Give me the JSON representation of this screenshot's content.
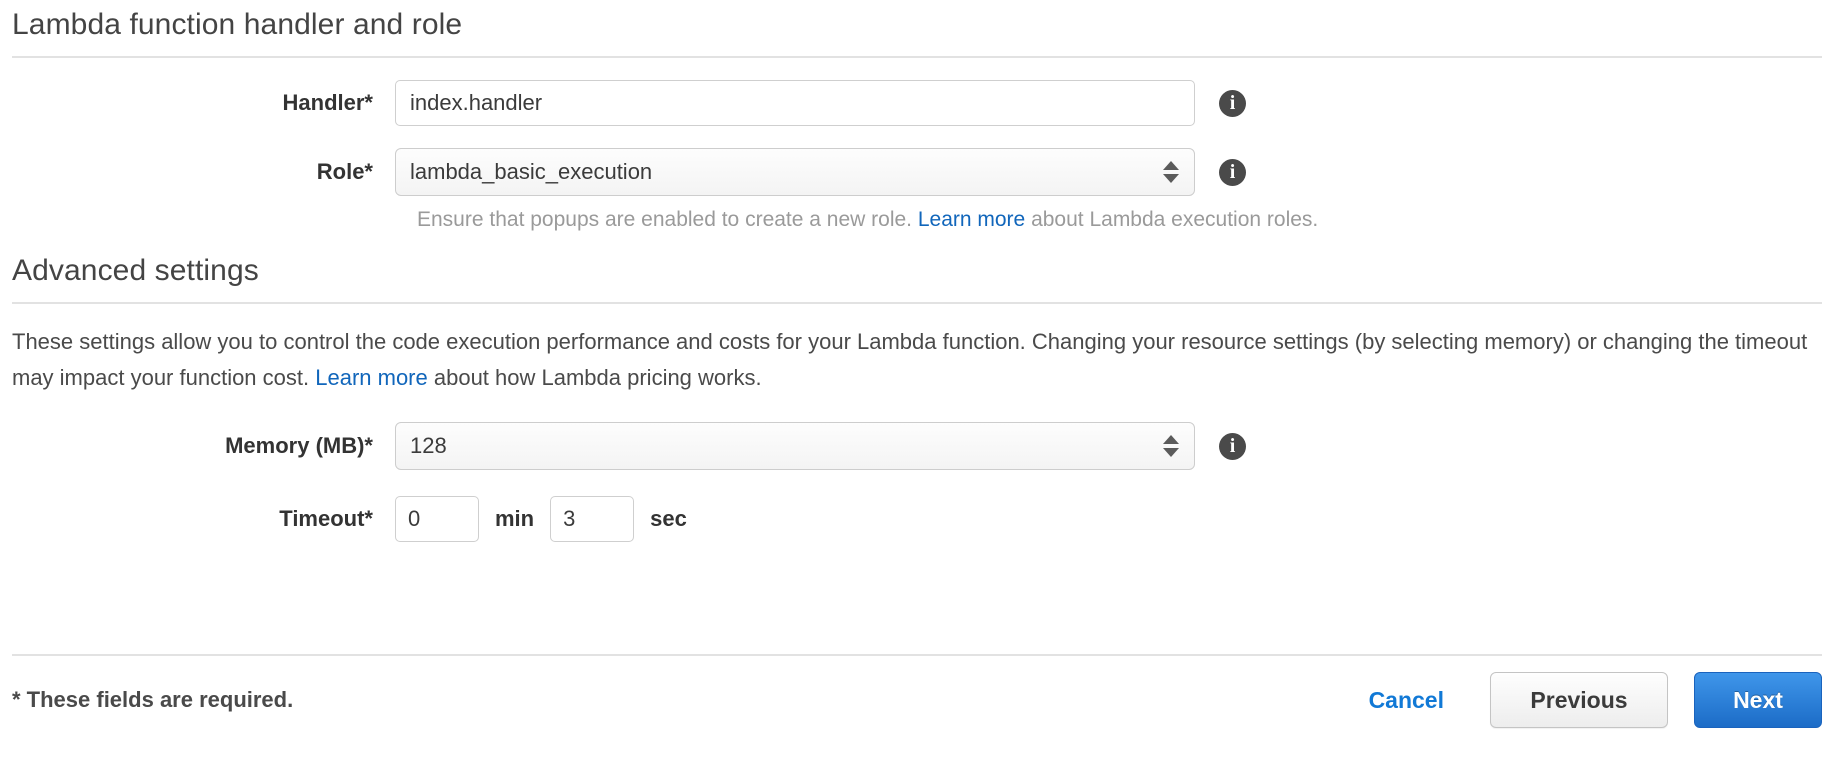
{
  "sections": {
    "handler_role": {
      "title": "Lambda function handler and role",
      "handler": {
        "label": "Handler*",
        "value": "index.handler",
        "placeholder": "",
        "info_icon": "info-icon"
      },
      "role": {
        "label": "Role*",
        "value": "lambda_basic_execution",
        "info_icon": "info-icon",
        "dropdown_icon": "stepper-arrows-icon"
      },
      "help": {
        "before_link": "Ensure that popups are enabled to create a new role. ",
        "link_text": "Learn more",
        "after_link": " about Lambda execution roles."
      }
    },
    "advanced": {
      "title": "Advanced settings",
      "description": {
        "before_link": "These settings allow you to control the code execution performance and costs for your Lambda function. Changing your resource settings (by selecting memory) or changing the timeout may impact your function cost. ",
        "link_text": "Learn more",
        "after_link": " about how Lambda pricing works."
      },
      "memory": {
        "label": "Memory (MB)*",
        "value": "128",
        "info_icon": "info-icon",
        "dropdown_icon": "stepper-arrows-icon"
      },
      "timeout": {
        "label": "Timeout*",
        "minutes": "0",
        "minutes_unit": "min",
        "seconds": "3",
        "seconds_unit": "sec"
      }
    }
  },
  "footer": {
    "required_note": "* These fields are required.",
    "cancel_label": "Cancel",
    "previous_label": "Previous",
    "next_label": "Next"
  },
  "colors": {
    "link_blue": "#1166bb",
    "cancel_blue": "#1179d6",
    "next_blue": "#1c6cc7",
    "text_dark": "#333333",
    "help_gray": "#9a9a9a",
    "divider": "#e2e2e2"
  }
}
